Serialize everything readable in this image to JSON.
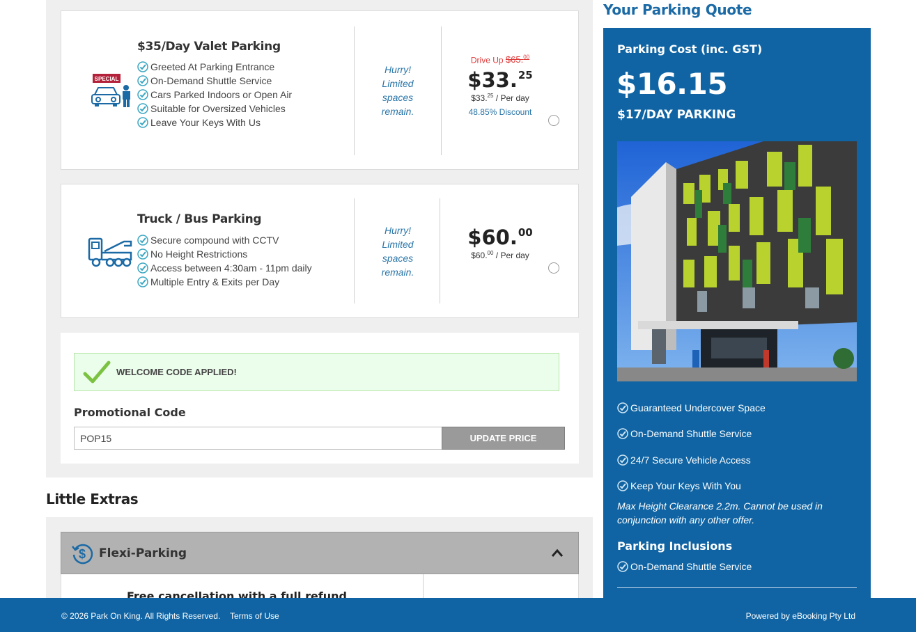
{
  "valet": {
    "title": "$35/Day Valet Parking",
    "badge": "SPECIAL",
    "features": [
      "Greeted At Parking Entrance",
      "On-Demand Shuttle Service",
      "Cars Parked Indoors or Open Air",
      "Suitable for Oversized Vehicles",
      "Leave Your Keys With Us"
    ],
    "hurry": [
      "Hurry!",
      "Limited",
      "spaces",
      "remain."
    ],
    "drive_up_label": "Drive Up",
    "drive_up_price": "$65.",
    "drive_up_cents": "00",
    "price": "$33.",
    "price_cents": "25",
    "per_day_price": "$33.",
    "per_day_cents": "25",
    "per_day_suffix": " / Per day",
    "discount": "48.85% Discount"
  },
  "truck": {
    "title": "Truck / Bus Parking",
    "features": [
      "Secure compound with CCTV",
      "No Height Restrictions",
      "Access between 4:30am - 11pm daily",
      "Multiple Entry & Exits per Day"
    ],
    "hurry": [
      "Hurry!",
      "Limited",
      "spaces",
      "remain."
    ],
    "price": "$60.",
    "price_cents": "00",
    "per_day_price": "$60.",
    "per_day_cents": "00",
    "per_day_suffix": " / Per day"
  },
  "promo": {
    "welcome": "WELCOME CODE APPLIED!",
    "label": "Promotional Code",
    "value": "POP15",
    "button": "UPDATE PRICE"
  },
  "extras": {
    "title": "Little Extras",
    "flexi_label": "Flexi-Parking",
    "refund_text": "Free cancellation with a full refund"
  },
  "quote": {
    "title": "Your Parking Quote",
    "cost_label": "Parking Cost (inc. GST)",
    "cost": "$16.15",
    "day_parking": "$17/DAY PARKING",
    "features": [
      "Guaranteed Undercover Space",
      "On-Demand Shuttle Service",
      "24/7 Secure Vehicle Access",
      "Keep Your Keys With You"
    ],
    "note": "Max Height Clearance 2.2m. Cannot be used in conjunction with any other offer.",
    "inclusions_title": "Parking Inclusions",
    "inclusions": [
      "On-Demand Shuttle Service"
    ]
  },
  "footer": {
    "copyright": "© 2026 Park On King. All Rights Reserved.",
    "terms": "Terms of Use",
    "powered": "Powered by eBooking Pty Ltd"
  },
  "colors": {
    "brand_blue": "#1064a3",
    "accent_teal": "#3aa6c2",
    "badge_red": "#b3223a",
    "success_green": "#ebfdeb"
  },
  "icons": [
    "valet-car-icon",
    "truck-icon",
    "check-circle-icon",
    "check-mark-icon",
    "dollar-refresh-icon",
    "chevron-up-icon"
  ]
}
